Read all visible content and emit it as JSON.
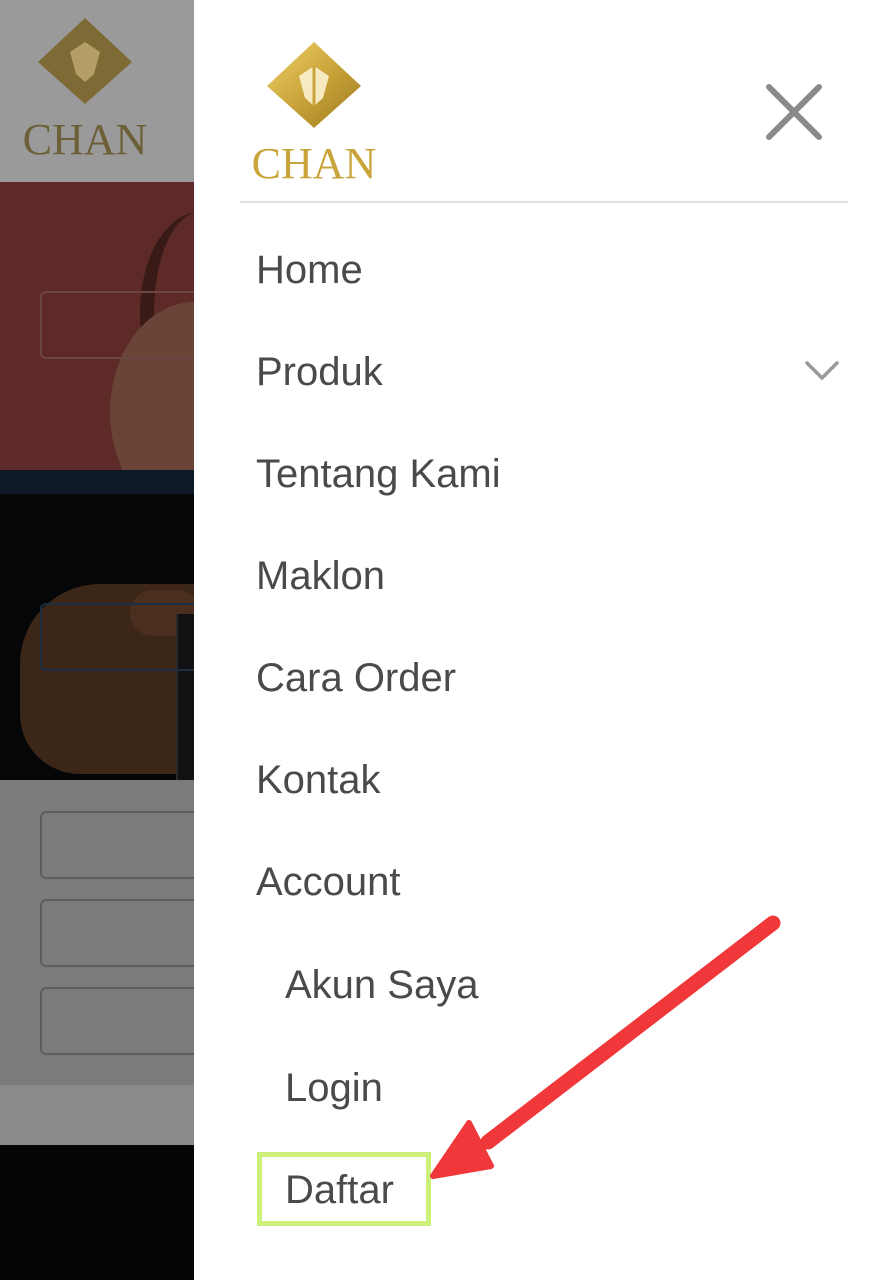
{
  "background": {
    "brand": "CHAN"
  },
  "drawer": {
    "brand": "CHAN",
    "close_icon": "close-icon",
    "menu": [
      {
        "label": "Home"
      },
      {
        "label": "Produk",
        "icon": "chevron-down-icon"
      },
      {
        "label": "Tentang Kami"
      },
      {
        "label": "Maklon"
      },
      {
        "label": "Cara Order"
      },
      {
        "label": "Kontak"
      },
      {
        "label": "Account"
      }
    ],
    "account_items": [
      {
        "label": "Akun Saya"
      },
      {
        "label": "Login"
      },
      {
        "label": "Daftar",
        "highlighted": true
      }
    ]
  },
  "colors": {
    "brand_gold": "#c9a43a",
    "highlight_green": "#ccf07a",
    "annotation_red": "#f0383b",
    "menu_text": "#4a4a4a"
  }
}
